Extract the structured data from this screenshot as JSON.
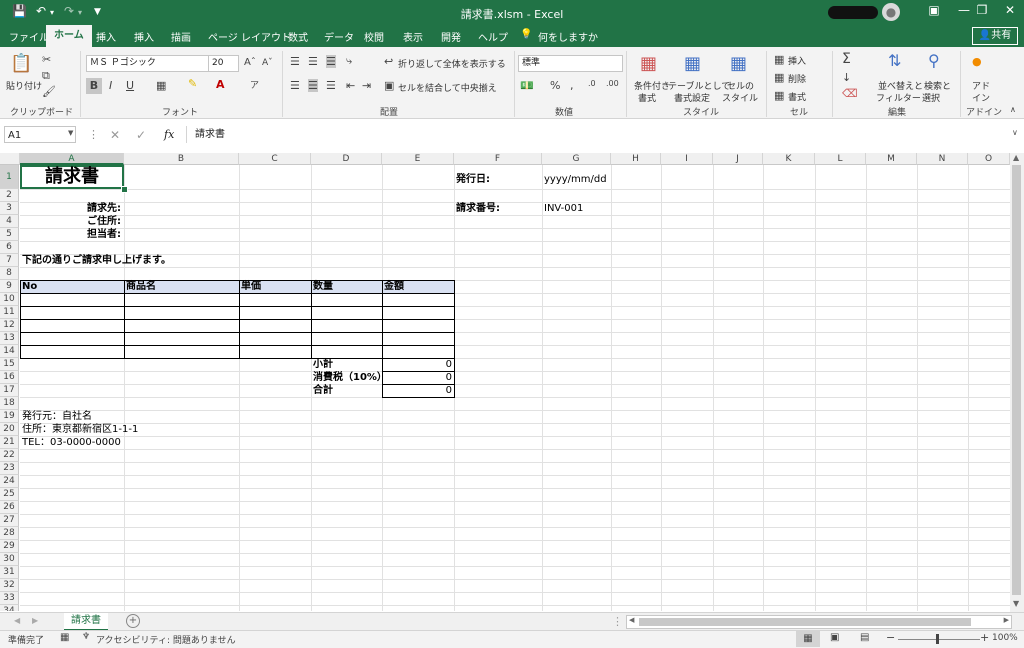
{
  "window": {
    "title": "請求書.xlsm  -  Excel",
    "share_label": "共有"
  },
  "tabs": [
    "ファイル",
    "ホーム",
    "挿入",
    "挿入",
    "描画",
    "ページ レイアウト",
    "数式",
    "データ",
    "校閲",
    "表示",
    "開発",
    "ヘルプ",
    "何をしますか"
  ],
  "ribbon": {
    "clipboard": {
      "paste": "貼り付け",
      "label": "クリップボード"
    },
    "font": {
      "name": "ＭＳ Ｐゴシック",
      "size": "20",
      "label": "フォント"
    },
    "alignment": {
      "wrap": "折り返して全体を表示する",
      "merge": "セルを結合して中央揃え",
      "label": "配置"
    },
    "number": {
      "format": "標準",
      "label": "数値"
    },
    "styles": {
      "cond1": "条件付き",
      "cond2": "書式",
      "table1": "テーブルとして",
      "table2": "書式設定",
      "cell1": "セルの",
      "cell2": "スタイル",
      "label": "スタイル"
    },
    "cells": {
      "insert": "挿入",
      "delete": "削除",
      "format": "書式",
      "label": "セル"
    },
    "editing": {
      "sort1": "並べ替えと",
      "sort2": "フィルター",
      "find1": "検索と",
      "find2": "選択",
      "label": "編集"
    },
    "addins": {
      "a1": "アド",
      "a2": "イン",
      "label": "アドイン"
    }
  },
  "formula_bar": {
    "name_box": "A1",
    "fx": "fx",
    "content": "請求書"
  },
  "columns": [
    "A",
    "B",
    "C",
    "D",
    "E",
    "F",
    "G",
    "H",
    "I",
    "J",
    "K",
    "L",
    "M",
    "N",
    "O"
  ],
  "rows": [
    "1",
    "2",
    "3",
    "4",
    "5",
    "6",
    "7",
    "8",
    "9",
    "10",
    "11",
    "12",
    "13",
    "14",
    "15",
    "16",
    "17",
    "18",
    "19",
    "20",
    "21",
    "22",
    "23",
    "24",
    "25",
    "26",
    "27",
    "28",
    "29",
    "30",
    "31",
    "32",
    "33",
    "34"
  ],
  "sheet": {
    "title": "請求書",
    "issue_date_label": "発行日:",
    "issue_date_value": "yyyy/mm/dd",
    "invoice_no_label": "請求番号:",
    "invoice_no_value": "INV-001",
    "to_label": "請求先:",
    "address_label": "ご住所:",
    "contact_label": "担当者:",
    "message": "下記の通りご請求申し上げます。",
    "table_headers": [
      "No",
      "商品名",
      "単価",
      "数量",
      "金額"
    ],
    "subtotal_label": "小計",
    "subtotal_value": "0",
    "tax_label": "消費税（10%）",
    "tax_value": "0",
    "total_label": "合計",
    "total_value": "0",
    "issuer": "発行元：自社名",
    "issuer_address": "住所：東京都新宿区1-1-1",
    "issuer_tel": "TEL：03-0000-0000"
  },
  "sheet_tab": "請求書",
  "status": {
    "ready": "準備完了",
    "accessibility": "アクセシビリティ: 問題ありません",
    "zoom": "100%"
  },
  "colors": {
    "excel_green": "#217346",
    "header_fill": "#d9e1f2"
  }
}
